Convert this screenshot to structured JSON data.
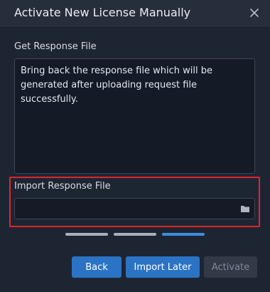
{
  "dialog": {
    "title": "Activate New License Manually",
    "close_icon": "close-icon"
  },
  "response_section": {
    "label": "Get Response File",
    "text": "Bring back the response file which will be generated after uploading request file successfully."
  },
  "import_section": {
    "label": "Import Response File",
    "value": "",
    "browse_icon": "folder-icon",
    "highlight_color": "#e0262a"
  },
  "steps": {
    "total": 3,
    "current": 3,
    "active_color": "#3b8fe0",
    "inactive_color": "#a9b0bc"
  },
  "buttons": {
    "back": "Back",
    "import_later": "Import Later",
    "activate": "Activate"
  },
  "colors": {
    "background": "#1e2532",
    "primary_button": "#2b73c4",
    "disabled_button": "#323a48"
  }
}
